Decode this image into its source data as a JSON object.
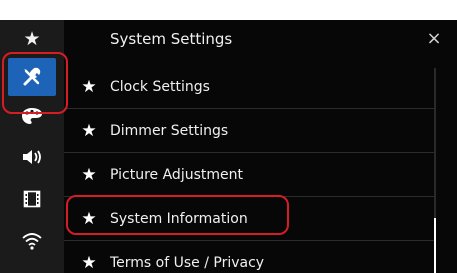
{
  "header": {
    "title": "System Settings",
    "close_glyph": "×"
  },
  "sidebar": {
    "items": [
      {
        "icon": "star-icon",
        "glyph": "★"
      },
      {
        "icon": "tools-icon",
        "active": true
      },
      {
        "icon": "palette-icon"
      },
      {
        "icon": "speaker-icon"
      },
      {
        "icon": "film-icon"
      },
      {
        "icon": "wifi-icon"
      }
    ]
  },
  "menu": {
    "items": [
      {
        "label": "Clock Settings",
        "star": "★"
      },
      {
        "label": "Dimmer Settings",
        "star": "★"
      },
      {
        "label": "Picture Adjustment",
        "star": "★"
      },
      {
        "label": "System Information",
        "star": "★"
      },
      {
        "label": "Terms of Use / Privacy",
        "star": "★"
      }
    ]
  },
  "scrollbar": {
    "position_fraction": 0.75
  },
  "colors": {
    "active_icon_bg": "#1d63b8",
    "highlight_outline": "#d51d24",
    "background": "#070707",
    "sidebar_bg": "#1b1b1b"
  }
}
